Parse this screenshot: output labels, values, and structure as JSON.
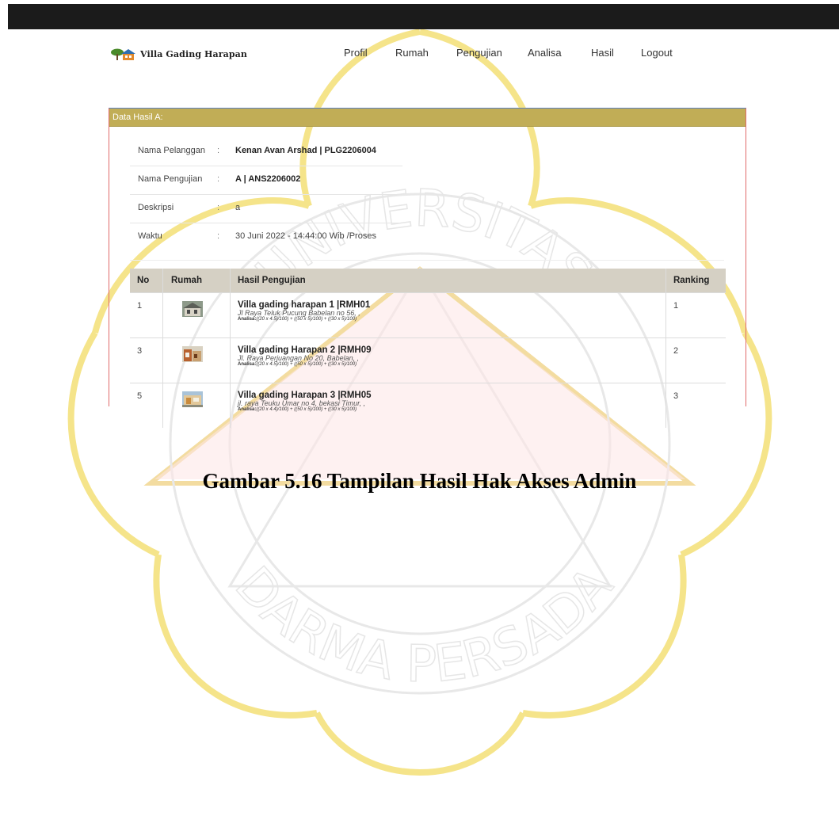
{
  "brand": {
    "name": "Villa Gading Harapan",
    "icon": "house-tree-logo-icon"
  },
  "nav": {
    "items": [
      "Profil",
      "Rumah",
      "Pengujian",
      "Analisa",
      "Hasil",
      "Logout"
    ]
  },
  "panel": {
    "title": "Data Hasil A:"
  },
  "info": [
    {
      "label": "Nama Pelanggan",
      "sep": ":",
      "value": "Kenan Avan Arshad | PLG2206004",
      "bold": true
    },
    {
      "label": "Nama Pengujian",
      "sep": ":",
      "value": "A | ANS2206002",
      "bold": true
    },
    {
      "label": "Deskripsi",
      "sep": ":",
      "value": "a",
      "bold": false
    },
    {
      "label": "Waktu",
      "sep": ":",
      "value": "30 Juni 2022 - 14:44:00 Wib /Proses",
      "bold": false
    }
  ],
  "table": {
    "headers": [
      "No",
      "Rumah",
      "Hasil Pengujian",
      "Ranking"
    ],
    "rows": [
      {
        "no": "1",
        "title": "Villa gading harapan 1 |RMH01",
        "address": "Jl Raya Teluk Pucung Babelan no 56, ,",
        "analisa_label": "Analisa:",
        "analisa": "((20 x 4.5)/100) + ((50 x 5)/100) + ((30 x 5)/100)",
        "ranking": "1",
        "thumb": "house-photo-icon"
      },
      {
        "no": "3",
        "title": "Villa gading Harapan 2 |RMH09",
        "address": "Jl. Raya Perjuangan No 20, Babelan, ,",
        "analisa_label": "Analisa:",
        "analisa": "((20 x 4.5)/100) + ((50 x 5)/100) + ((30 x 5)/100)",
        "ranking": "2",
        "thumb": "house-photo-icon"
      },
      {
        "no": "5",
        "title": "Villa gading Harapan 3 |RMH05",
        "address": "jl. raya Teuku Umar no 4, bekasi Timur, ,",
        "analisa_label": "Analisa:",
        "analisa": "((20 x 4.4)/100) + ((50 x 5)/100) + ((30 x 5)/100)",
        "ranking": "3",
        "thumb": "house-photo-icon"
      }
    ]
  },
  "caption": "Gambar 5.16 Tampilan Hasil Hak Akses Admin",
  "watermark": {
    "text_top": "UNIVERSITAS",
    "text_bottom": "DARMA PERSADA",
    "color": "#f3e06a"
  },
  "colors": {
    "panel_header": "#c1ad56",
    "table_header": "#d5d0c4",
    "topbar": "#1b1b1b"
  }
}
